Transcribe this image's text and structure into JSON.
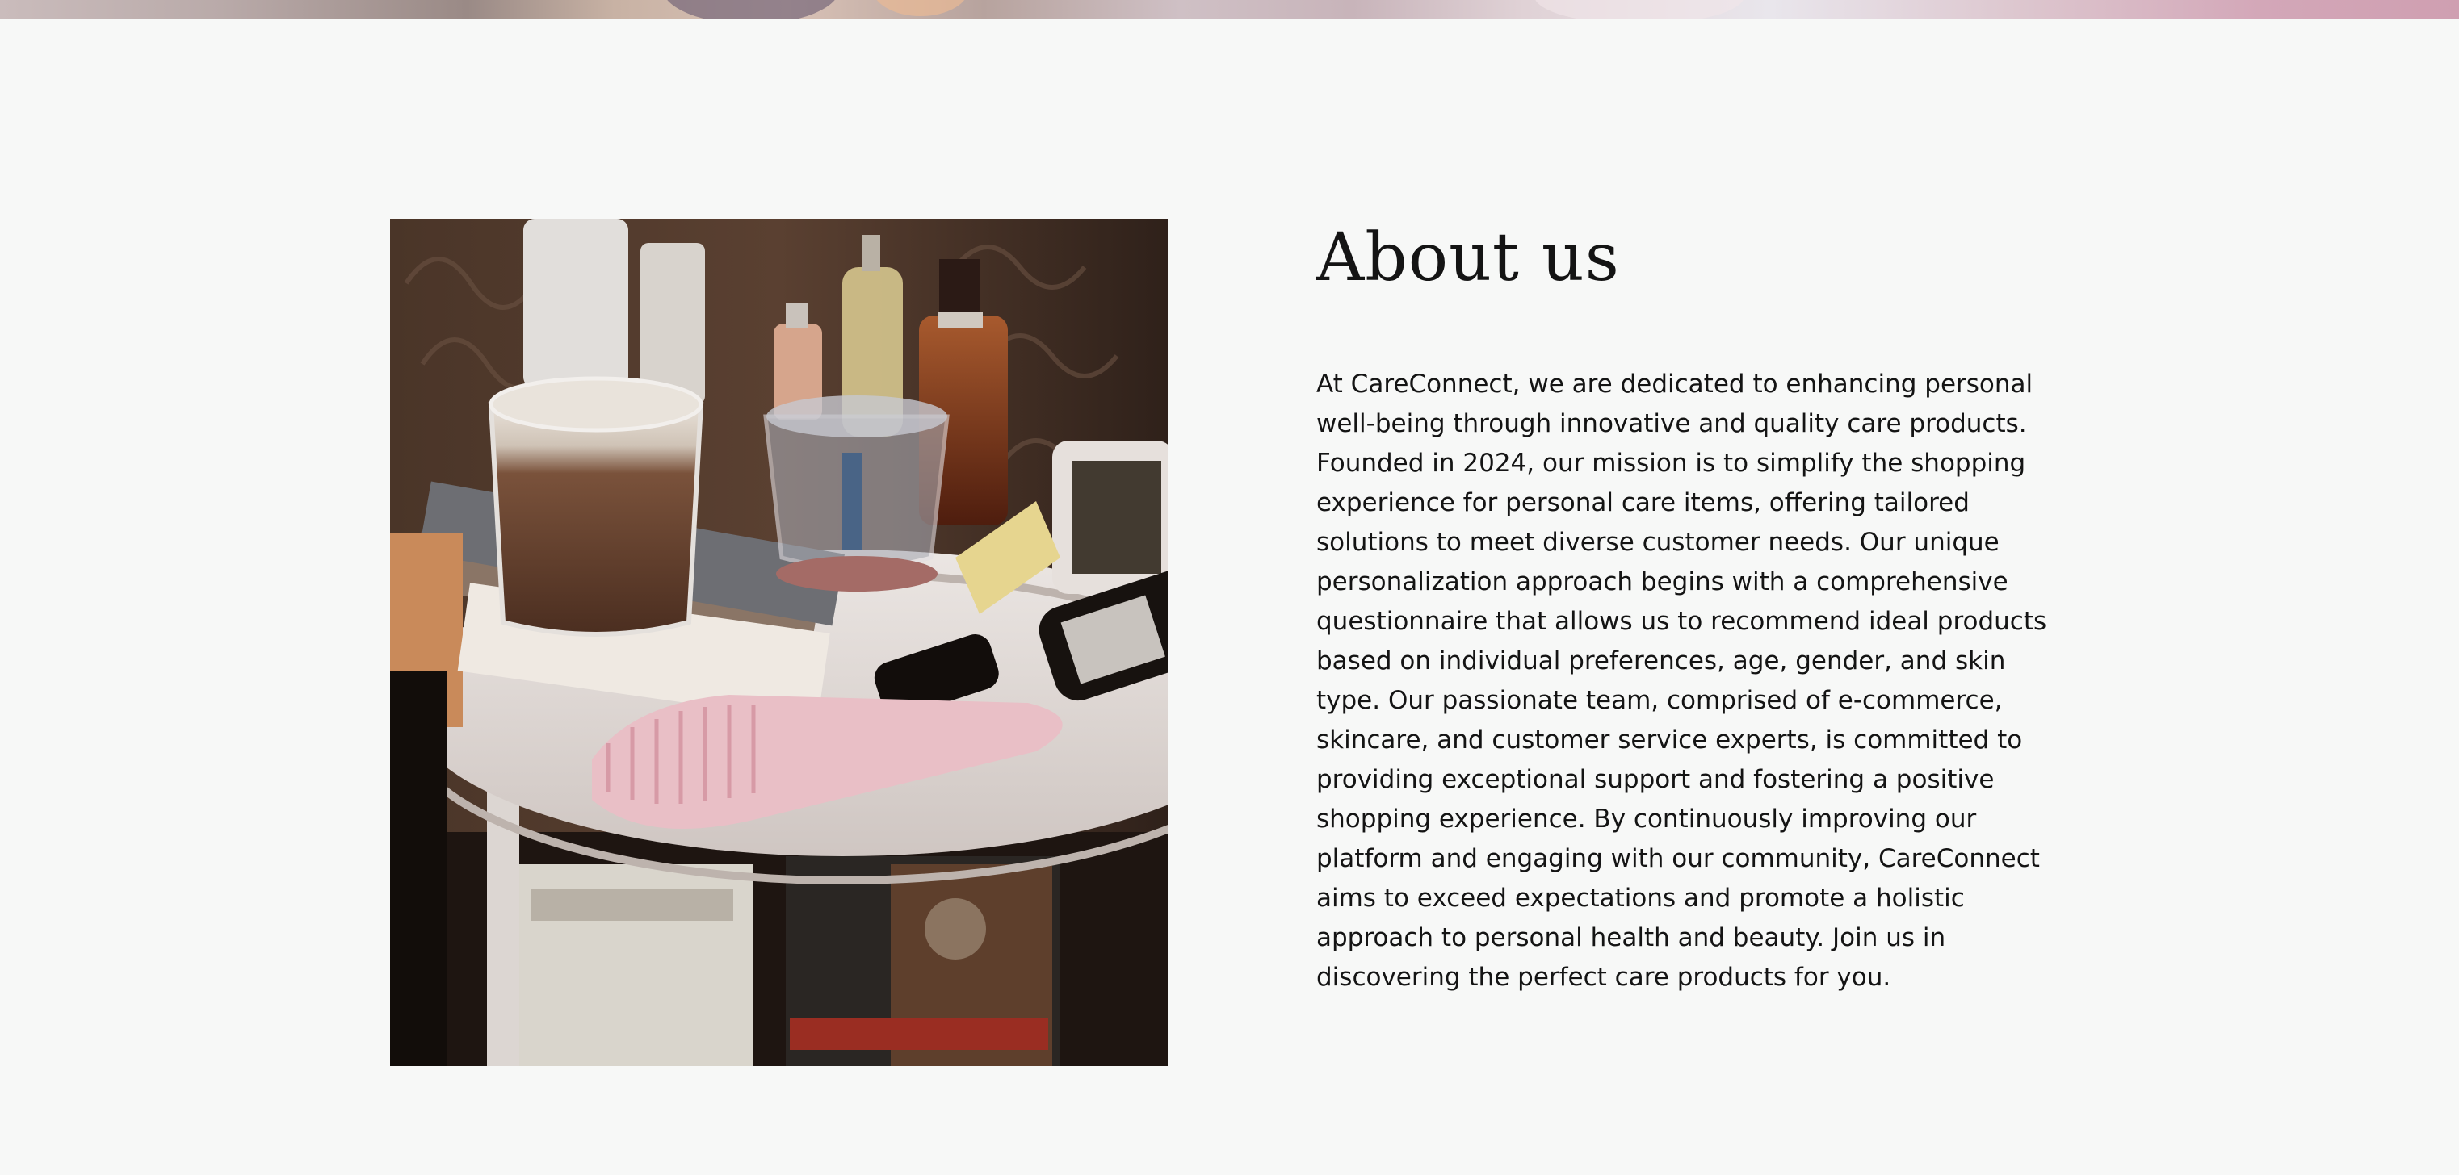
{
  "about": {
    "title": "About us",
    "body": "At CareConnect, we are dedicated to enhancing personal well-being through innovative and quality care products. Founded in 2024, our mission is to simplify the shopping experience for personal care items, offering tailored solutions to meet diverse customer needs. Our unique personalization approach begins with a comprehensive questionnaire that allows us to recommend ideal products based on individual preferences, age, gender, and skin type. Our passionate team, comprised of e-commerce, skincare, and customer service experts, is committed to providing exceptional support and fostering a positive shopping experience. By continuously improving our platform and engaging with our community, CareConnect aims to exceed expectations and promote a holistic approach to personal health and beauty. Join us in discovering the perfect care products for you."
  },
  "colors": {
    "background": "#f7f8f7",
    "text": "#141414"
  }
}
